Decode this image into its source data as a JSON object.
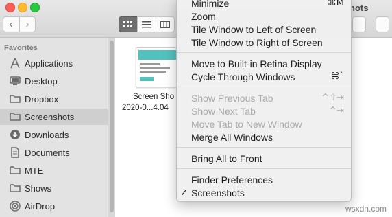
{
  "window": {
    "title": "hots",
    "nav_back": "‹",
    "nav_forward": "›"
  },
  "sidebar": {
    "heading": "Favorites",
    "items": [
      {
        "label": "Applications",
        "icon": "applications-icon"
      },
      {
        "label": "Desktop",
        "icon": "desktop-icon"
      },
      {
        "label": "Dropbox",
        "icon": "dropbox-icon"
      },
      {
        "label": "Screenshots",
        "icon": "folder-icon",
        "selected": true
      },
      {
        "label": "Downloads",
        "icon": "downloads-icon"
      },
      {
        "label": "Documents",
        "icon": "documents-icon"
      },
      {
        "label": "MTE",
        "icon": "folder-icon"
      },
      {
        "label": "Shows",
        "icon": "folder-icon"
      },
      {
        "label": "AirDrop",
        "icon": "airdrop-icon"
      }
    ]
  },
  "file": {
    "name_line1": "Screen Sho",
    "name_line2": "2020-0...4.04"
  },
  "menu": {
    "items": [
      {
        "label": "Minimize",
        "shortcut": "⌘M"
      },
      {
        "label": "Zoom",
        "shortcut": ""
      },
      {
        "label": "Tile Window to Left of Screen",
        "shortcut": ""
      },
      {
        "label": "Tile Window to Right of Screen",
        "shortcut": ""
      },
      {
        "label": "Move to Built-in Retina Display",
        "shortcut": ""
      },
      {
        "label": "Cycle Through Windows",
        "shortcut": "⌘`"
      },
      {
        "label": "Show Previous Tab",
        "shortcut": "^⇧⇥",
        "disabled": true
      },
      {
        "label": "Show Next Tab",
        "shortcut": "^⇥",
        "disabled": true
      },
      {
        "label": "Move Tab to New Window",
        "shortcut": "",
        "disabled": true
      },
      {
        "label": "Merge All Windows",
        "shortcut": ""
      },
      {
        "label": "Bring All to Front",
        "shortcut": ""
      },
      {
        "label": "Finder Preferences",
        "shortcut": ""
      },
      {
        "label": "Screenshots",
        "shortcut": "",
        "checked": true,
        "check": "✓"
      }
    ]
  },
  "watermark": "wsxdn.com"
}
